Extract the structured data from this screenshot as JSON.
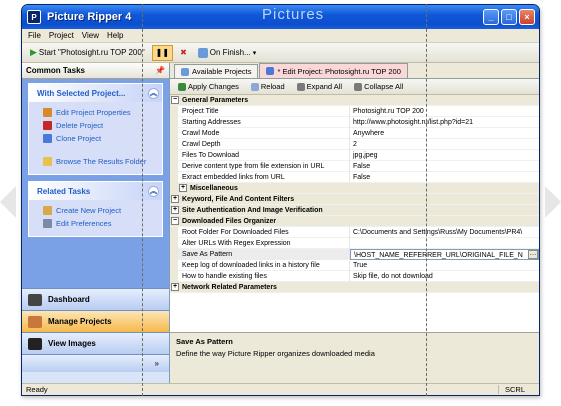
{
  "window": {
    "app_title": "Picture Ripper 4",
    "overlay_title": "Pictures",
    "minimize": "_",
    "maximize": "□",
    "close": "×"
  },
  "menu": [
    "File",
    "Project",
    "View",
    "Help"
  ],
  "toolbar": {
    "start_label": "Start \"Photosight.ru TOP 200\"",
    "on_finish_label": "On Finish..."
  },
  "left_pane": {
    "title": "Common Tasks",
    "groups": [
      {
        "title": "With Selected Project...",
        "items": [
          "Edit Project Properties",
          "Delete Project",
          "Clone Project",
          "Browse The Results Folder"
        ]
      },
      {
        "title": "Related Tasks",
        "items": [
          "Create New Project",
          "Edit Preferences"
        ]
      }
    ],
    "nav": [
      "Dashboard",
      "Manage Projects",
      "View Images"
    ],
    "nav_more": "»"
  },
  "tabs": [
    "Available Projects",
    "* Edit Project: Photosight.ru TOP 200"
  ],
  "property_toolbar": [
    "Apply Changes",
    "Reload",
    "Expand All",
    "Collapse All"
  ],
  "properties": [
    {
      "kind": "cat",
      "toggle": "−",
      "name": "General Parameters"
    },
    {
      "kind": "prop",
      "name": "Project Title",
      "value": "Photosight.ru TOP 200"
    },
    {
      "kind": "prop",
      "name": "Starting Addresses",
      "value": "http://www.photosight.ru/list.php?id=21"
    },
    {
      "kind": "prop",
      "name": "Crawl Mode",
      "value": "Anywhere"
    },
    {
      "kind": "prop",
      "name": "Crawl Depth",
      "value": "2"
    },
    {
      "kind": "prop",
      "name": "Files To Download",
      "value": "jpg,jpeg"
    },
    {
      "kind": "prop",
      "name": "Derive content type from file extension in URL",
      "value": "False"
    },
    {
      "kind": "prop",
      "name": "Exract embedded links from URL",
      "value": "False"
    },
    {
      "kind": "sub",
      "toggle": "+",
      "name": "Miscellaneous"
    },
    {
      "kind": "cat",
      "toggle": "+",
      "name": "Keyword, File And Content Filters"
    },
    {
      "kind": "cat",
      "toggle": "+",
      "name": "Site Authentication And Image Verification"
    },
    {
      "kind": "cat",
      "toggle": "−",
      "name": "Downloaded Files Organizer"
    },
    {
      "kind": "prop",
      "name": "Root Folder For Downloaded Files",
      "value": "C:\\Documents and Settings\\Russ\\My Documents\\PR4\\"
    },
    {
      "kind": "prop",
      "name": "Alter URLs With Regex Expression",
      "value": ""
    },
    {
      "kind": "sel",
      "name": "Save As Pattern",
      "value": "\\HOST_NAME_REFERRER_URL\\ORIGINAL_FILE_N"
    },
    {
      "kind": "prop",
      "name": "Keep log of downloaded links in a history file",
      "value": "True"
    },
    {
      "kind": "prop",
      "name": "How to handle existing files",
      "value": "Skip file, do not download"
    },
    {
      "kind": "cat",
      "toggle": "+",
      "name": "Network Related Parameters"
    }
  ],
  "description": {
    "title": "Save As Pattern",
    "text": "Define the way Picture Ripper organizes downloaded media"
  },
  "status": {
    "left": "Ready",
    "right": "SCRL"
  }
}
